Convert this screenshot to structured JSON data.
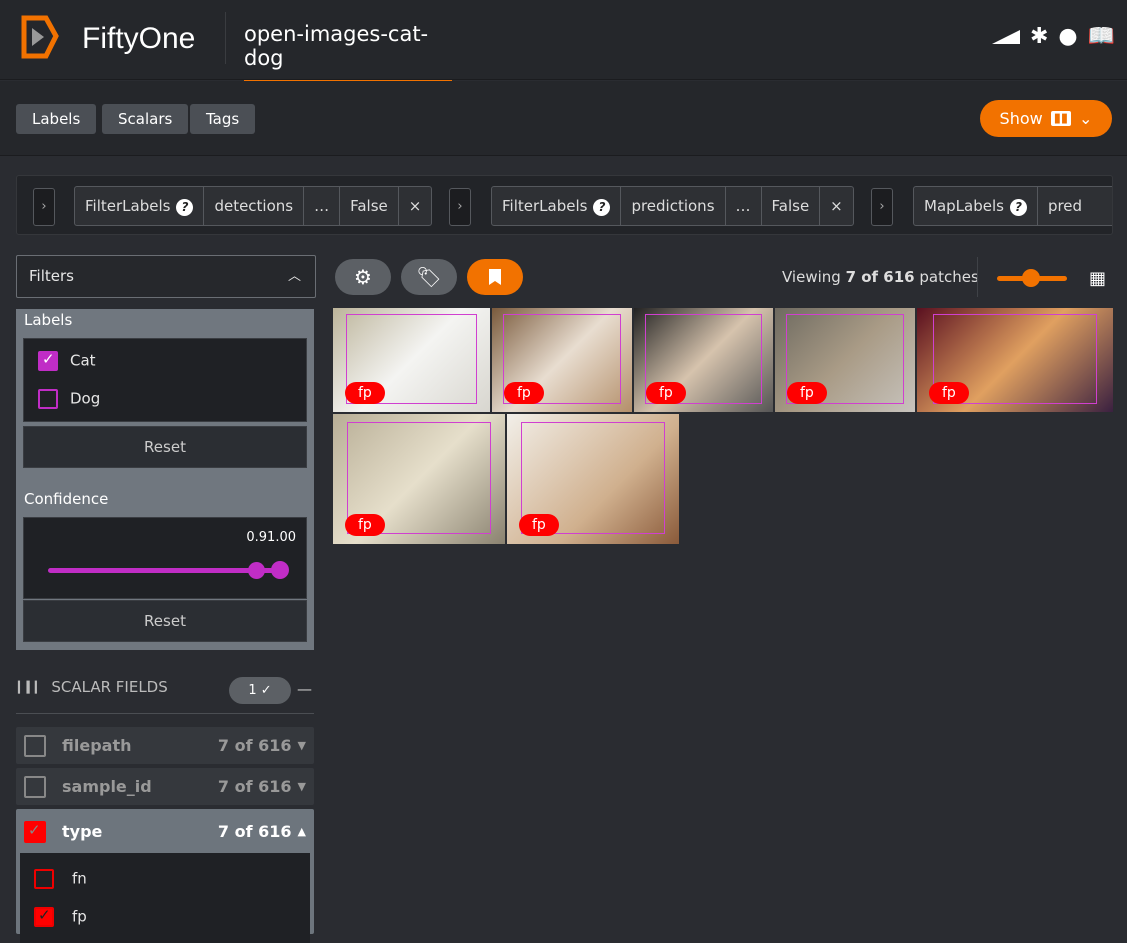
{
  "header": {
    "brand": "FiftyOne",
    "dataset": "open-images-cat-dog",
    "icons": [
      "signal-icon",
      "slack-icon",
      "github-icon",
      "docs-icon"
    ]
  },
  "toolbar": {
    "tabs": [
      "Labels",
      "Scalars",
      "Tags"
    ],
    "show_label": "Show"
  },
  "stages": [
    {
      "name": "FilterLabels",
      "field": "detections",
      "more": "…",
      "value": "False",
      "close": "×"
    },
    {
      "name": "FilterLabels",
      "field": "predictions",
      "more": "…",
      "value": "False",
      "close": "×"
    },
    {
      "name": "MapLabels",
      "field": "pred"
    }
  ],
  "sidebar": {
    "filters_label": "Filters",
    "labels_title": "Labels",
    "labels": [
      {
        "label": "Cat",
        "checked": true
      },
      {
        "label": "Dog",
        "checked": false
      }
    ],
    "reset": "Reset",
    "confidence_title": "Confidence",
    "confidence_range": "0.91.00",
    "confidence_low": 0.91,
    "confidence_high": 1.0,
    "scalar_title": "SCALAR FIELDS",
    "scalar_badge": "1 ✓",
    "scalar_fields": [
      {
        "name": "filepath",
        "count": "7 of 616",
        "checked": false
      },
      {
        "name": "sample_id",
        "count": "7 of 616",
        "checked": false
      },
      {
        "name": "type",
        "count": "7 of 616",
        "checked": true
      }
    ],
    "type_values": [
      {
        "label": "fn",
        "checked": false
      },
      {
        "label": "fp",
        "checked": true
      }
    ]
  },
  "grid": {
    "viewing_prefix": "Viewing ",
    "viewing_count": "7 of 616",
    "viewing_suffix": " patches",
    "tag": "fp",
    "accent": "#f27200"
  }
}
